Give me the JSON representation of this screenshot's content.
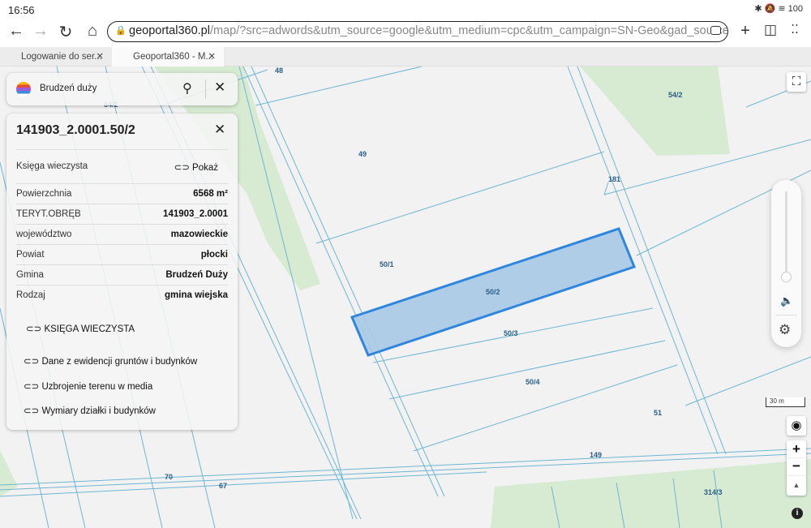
{
  "status": {
    "time": "16:56",
    "icons": "✱ 🔕 ≋ 100"
  },
  "browser": {
    "url_host": "geoportal360.pl",
    "url_rest": "/map/?src=adwords&utm_source=google&utm_medium=cpc&utm_campaign=SN-Geo&gad_source=1&gad_camp",
    "tabs": [
      {
        "label": "Logowanie do ser..."
      },
      {
        "label": "Geoportal360 - M..."
      }
    ]
  },
  "search": {
    "query": "Brudzeń duży"
  },
  "parcel": {
    "title": "141903_2.0001.50/2",
    "kw_label": "Księga wieczysta",
    "kw_action": "Pokaż",
    "rows": [
      {
        "k": "Powierzchnia",
        "v": "6568 m²"
      },
      {
        "k": "TERYT.OBRĘB",
        "v": "141903_2.0001"
      },
      {
        "k": "województwo",
        "v": "mazowieckie"
      },
      {
        "k": "Powiat",
        "v": "płocki"
      },
      {
        "k": "Gmina",
        "v": "Brudzeń Duży"
      },
      {
        "k": "Rodzaj",
        "v": "gmina wiejska"
      }
    ],
    "kw_button": "KSIĘGA WIECZYSTA",
    "links": [
      "Dane z ewidencji gruntów i budynków",
      "Uzbrojenie terenu w media",
      "Wymiary działki i budynków"
    ]
  },
  "map": {
    "labels": [
      "48",
      "64/2",
      "49",
      "54/2",
      "181",
      "50/1",
      "50/2",
      "50/3",
      "50/4",
      "51",
      "149",
      "70",
      "67",
      "314/3"
    ],
    "scale": "30 m",
    "highlight_color": "#2e86de"
  }
}
